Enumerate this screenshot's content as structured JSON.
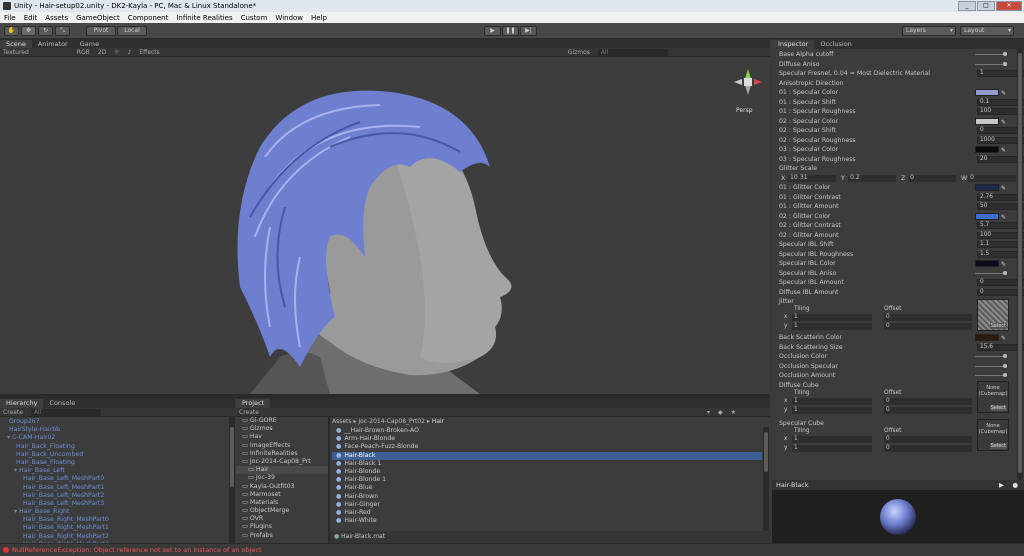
{
  "window": {
    "title": "Unity - Hair-setup02.unity - DK2-Kayla - PC, Mac & Linux Standalone*"
  },
  "menu": [
    "File",
    "Edit",
    "Assets",
    "GameObject",
    "Component",
    "Infinite Realities",
    "Custom",
    "Window",
    "Help"
  ],
  "toolbar": {
    "pivot_label": "Pivot",
    "local_label": "Local",
    "layers_label": "Layers",
    "layout_label": "Layout"
  },
  "scene": {
    "tabs": [
      "Scene",
      "Animator",
      "Game"
    ],
    "subbar": {
      "shading": "Textured",
      "mode": "RGB",
      "twod": "2D",
      "effects": "Effects",
      "gizmos": "Gizmos",
      "search_placeholder": "All"
    },
    "persp_label": "Persp"
  },
  "hierarchy": {
    "tabs": [
      "Hierarchy",
      "Console"
    ],
    "create_label": "Create",
    "search_placeholder": "All",
    "items": [
      {
        "label": "Group267",
        "indent": 1
      },
      {
        "label": "HairStyle-Hairbb",
        "indent": 1
      },
      {
        "label": "C-CAM-Hair02",
        "indent": 1
      },
      {
        "label": "Hair_Back_Floating",
        "indent": 2
      },
      {
        "label": "Hair_Back_Uncombed",
        "indent": 2
      },
      {
        "label": "Hair_Base_Floating",
        "indent": 2
      },
      {
        "label": "Hair_Base_Left",
        "indent": 2
      },
      {
        "label": "Hair_Base_Left_MeshPart0",
        "indent": 3
      },
      {
        "label": "Hair_Base_Left_MeshPart1",
        "indent": 3
      },
      {
        "label": "Hair_Base_Left_MeshPart2",
        "indent": 3
      },
      {
        "label": "Hair_Base_Left_MeshPart3",
        "indent": 3
      },
      {
        "label": "Hair_Base_Right",
        "indent": 2
      },
      {
        "label": "Hair_Base_Right_MeshPart0",
        "indent": 3
      },
      {
        "label": "Hair_Base_Right_MeshPart1",
        "indent": 3
      },
      {
        "label": "Hair_Base_Right_MeshPart2",
        "indent": 3
      },
      {
        "label": "Hair_Base_Right_MeshPart3",
        "indent": 3
      }
    ]
  },
  "project": {
    "tab": "Project",
    "create_label": "Create",
    "folders": [
      {
        "label": "Gi-GORE",
        "indent": 1
      },
      {
        "label": "Gizmos",
        "indent": 1
      },
      {
        "label": "Hav",
        "indent": 1
      },
      {
        "label": "ImageEffects",
        "indent": 1
      },
      {
        "label": "InfiniteRealities",
        "indent": 1
      },
      {
        "label": "Joc-2014-Cap08_Prt",
        "indent": 1
      },
      {
        "label": "Hair",
        "indent": 2
      },
      {
        "label": "Joc-39",
        "indent": 2
      },
      {
        "label": "Kayla-Outfit03",
        "indent": 1
      },
      {
        "label": "Marmoset",
        "indent": 1
      },
      {
        "label": "Materials",
        "indent": 1
      },
      {
        "label": "ObjectMerge",
        "indent": 1
      },
      {
        "label": "OVR",
        "indent": 1
      },
      {
        "label": "Plugins",
        "indent": 1
      },
      {
        "label": "Prefabs",
        "indent": 1
      }
    ],
    "breadcrumb": [
      "Assets",
      "Joc-2014-Cap08_Prt02",
      "Hair"
    ],
    "assets": [
      "__Hair-Brown-Broken-AO",
      "Arm-Hair-Blonde",
      "Face-Peach-Fuzz-Blonde",
      "Hair-Black",
      "Hair-Black 1",
      "Hair-Blonde",
      "Hair-Blonde 1",
      "Hair-Blue",
      "Hair-Brown",
      "Hair-Ginger",
      "Hair-Red",
      "Hair-White"
    ],
    "selected_asset": "Hair-Black",
    "footer": "Hair-Black.mat"
  },
  "inspector": {
    "tabs": [
      "Inspector",
      "Occlusion"
    ],
    "rows": [
      {
        "label": "Base Alpha cutoff",
        "kind": "slider"
      },
      {
        "label": "Diffuse Aniso",
        "kind": "slider"
      },
      {
        "label": "Specular Fresnel, 0.04 = Most Dielectric Material",
        "kind": "value",
        "value": "1"
      },
      {
        "label": "Anisotropic Direction",
        "kind": "none"
      },
      {
        "label": "01 : Specular Color",
        "kind": "color",
        "color": "#9a9ad2"
      },
      {
        "label": "01 : Specular Shift",
        "kind": "value",
        "value": "0.1"
      },
      {
        "label": "01 : Specular Roughness",
        "kind": "value",
        "value": "100"
      },
      {
        "label": "02 : Specular Color",
        "kind": "color",
        "color": "#c7c7c7"
      },
      {
        "label": "02 : Specular Shift",
        "kind": "value",
        "value": "0"
      },
      {
        "label": "02 : Specular Roughness",
        "kind": "value",
        "value": "1000"
      },
      {
        "label": "03 : Specular Color",
        "kind": "color",
        "color": "#0a0a0a"
      },
      {
        "label": "03 : Specular Roughness",
        "kind": "value",
        "value": "20"
      },
      {
        "label": "Glitter Scale",
        "kind": "none"
      },
      {
        "label": "",
        "kind": "vector",
        "vx": "10.31",
        "vy": "0.2",
        "vz": "0",
        "vw": "0"
      },
      {
        "label": "01 : Glitter Color",
        "kind": "color",
        "color": "#1d2a4a"
      },
      {
        "label": "01 : Glitter Contrast",
        "kind": "value",
        "value": "2.76"
      },
      {
        "label": "01 : Glitter Amount",
        "kind": "value",
        "value": "50"
      },
      {
        "label": "02 : Glitter Color",
        "kind": "color",
        "color": "#3f6ed0"
      },
      {
        "label": "02 : Glitter Contrast",
        "kind": "value",
        "value": "5.7"
      },
      {
        "label": "02 : Glitter Amount",
        "kind": "value",
        "value": "100"
      },
      {
        "label": "Specular IBL Shift",
        "kind": "value",
        "value": "1.1"
      },
      {
        "label": "Specular IBL Roughness",
        "kind": "value",
        "value": "1.5"
      },
      {
        "label": "Specular IBL Color",
        "kind": "color",
        "color": "#0a0a1a"
      },
      {
        "label": "Specular IBL Aniso",
        "kind": "slider"
      },
      {
        "label": "Specular IBL Amount",
        "kind": "value",
        "value": "0"
      },
      {
        "label": "Diffuse IBL Amount",
        "kind": "value",
        "value": "0"
      }
    ],
    "jitter": {
      "label": "Jitter",
      "tiling": "Tiling",
      "offset": "Offset",
      "x": "1",
      "y": "1",
      "ox": "0",
      "oy": "0",
      "select": "Select"
    },
    "rows2": [
      {
        "label": "Back Scatterin Color",
        "kind": "color",
        "color": "#2a1a10"
      },
      {
        "label": "Back Scattering Size",
        "kind": "value",
        "value": "15.6"
      },
      {
        "label": "Occlusion Color",
        "kind": "slider"
      },
      {
        "label": "Occlusion Specular",
        "kind": "slider"
      },
      {
        "label": "Occlusion Amount",
        "kind": "slider"
      }
    ],
    "diffuse_cube": {
      "label": "Diffuse Cube",
      "tiling": "Tiling",
      "offset": "Offset",
      "x": "1",
      "y": "1",
      "ox": "0",
      "oy": "0",
      "none": "None",
      "type": "(Cubemap)",
      "select": "Select"
    },
    "specular_cube": {
      "label": "Specular Cube",
      "tiling": "Tiling",
      "offset": "Offset",
      "x": "1",
      "y": "1",
      "ox": "0",
      "oy": "0",
      "none": "None",
      "type": "(Cubemap)",
      "select": "Select"
    },
    "preview_title": "Hair-Black"
  },
  "status": {
    "error": "NullReferenceException: Object reference not set to an instance of an object"
  },
  "colors": {
    "hair": "#6f7fd0",
    "skin": "#9a9a9a",
    "accent": "#3d6fd6"
  }
}
